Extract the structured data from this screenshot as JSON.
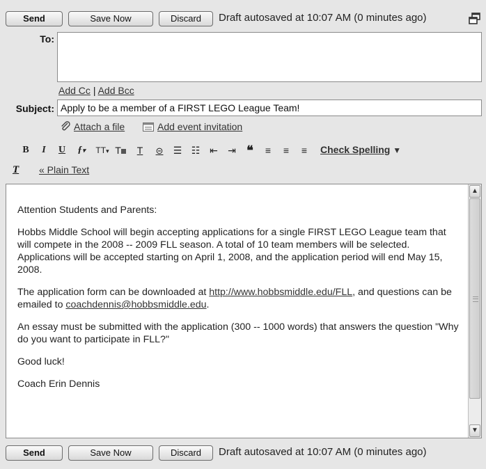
{
  "top_bar": {
    "send_label": "Send",
    "save_label": "Save Now",
    "discard_label": "Discard",
    "status_text": "Draft autosaved at 10:07 AM (0 minutes ago)",
    "popout_icon": "new-window-icon"
  },
  "compose": {
    "to_label": "To:",
    "to_value": "",
    "add_cc": "Add Cc",
    "separator": "|",
    "add_bcc": "Add Bcc",
    "subject_label": "Subject:",
    "subject_value": "Apply to be a member of a FIRST LEGO League Team!",
    "attach_label": "Attach a file",
    "event_label": "Add event invitation"
  },
  "formatting": {
    "bold": "B",
    "italic": "I",
    "underline": "U",
    "font": "ƒ",
    "size": "TT",
    "check_spelling": "Check Spelling",
    "plain_text": "« Plain Text"
  },
  "message": {
    "greeting": "Attention Students and Parents:",
    "para1": "Hobbs Middle School will begin accepting applications for a single FIRST LEGO League team that will compete in the 2008 -- 2009 FLL season.  A total of 10 team members will be selected.  Applications will be accepted starting on April 1, 2008, and the application period will end May 15, 2008.",
    "para2_a": "The application form can be downloaded at ",
    "para2_link": "http://www.hobbsmiddle.edu/FLL",
    "para2_b": ", and questions can be emailed to ",
    "para2_email": "coachdennis@hobbsmiddle.edu",
    "para2_c": ".",
    "para3": "An essay must be submitted with the application (300 -- 1000 words) that answers the question \"Why do you want to participate in FLL?\"",
    "closing": "Good luck!",
    "signature": "Coach Erin Dennis"
  },
  "bottom_bar": {
    "send_label": "Send",
    "save_label": "Save Now",
    "discard_label": "Discard",
    "status_text": "Draft autosaved at 10:07 AM (0 minutes ago)"
  }
}
